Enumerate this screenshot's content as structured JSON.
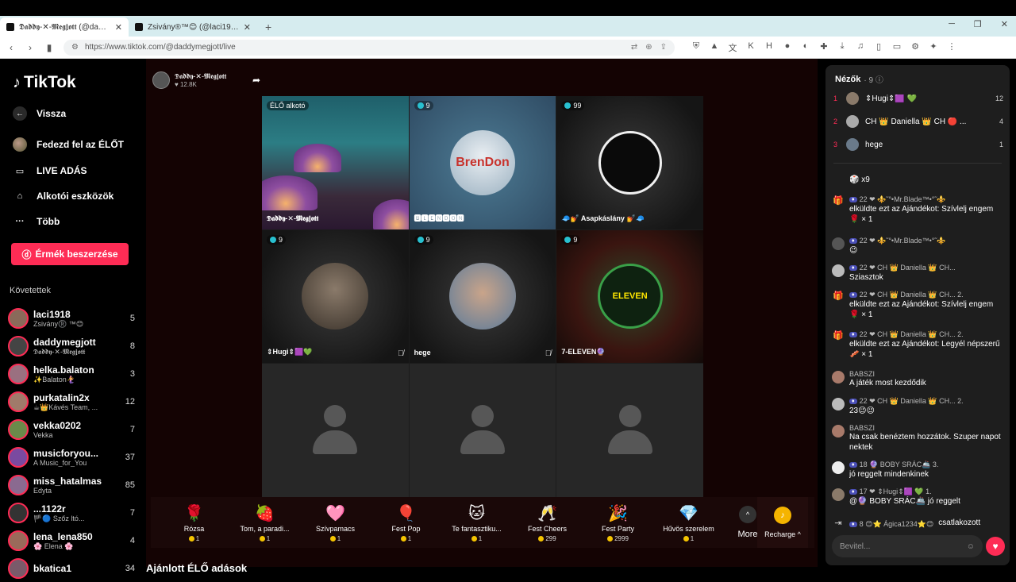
{
  "browser": {
    "tabs": [
      {
        "title": "𝕯𝖆𝖉𝖉𝖞-✕-𝕸𝖊𝖌𝖏𝖔𝖙𝖙 (@daddymegjott)",
        "active": true
      },
      {
        "title": "Zsivány®™😊 (@laci1918) ÉLŐ a",
        "active": false
      }
    ],
    "url": "https://www.tiktok.com/@daddymegjott/live"
  },
  "sidebar": {
    "logo": "TikTok",
    "nav": [
      {
        "label": "Vissza"
      },
      {
        "label": "Fedezd fel az ÉLŐT"
      },
      {
        "label": "LIVE ADÁS"
      },
      {
        "label": "Alkotói eszközök"
      },
      {
        "label": "Több"
      }
    ],
    "coin_button": "Érmék beszerzése",
    "following_title": "Követettek",
    "following": [
      {
        "name": "laci1918",
        "sub": "Zsivány®️ ™😊",
        "count": "5"
      },
      {
        "name": "daddymegjott",
        "sub": "𝕯𝖆𝖉𝖉𝖞-✕-𝕸𝖊𝖌𝖏𝖔𝖙𝖙",
        "count": "8"
      },
      {
        "name": "helka.balaton",
        "sub": "✨Balaton🧜‍♀️",
        "count": "3"
      },
      {
        "name": "purkatalin2x",
        "sub": "☕👑Kávés Team, ...",
        "count": "12"
      },
      {
        "name": "vekka0202",
        "sub": "Vekka",
        "count": "7"
      },
      {
        "name": "musicforyou...",
        "sub": "A Music_for_You",
        "count": "37"
      },
      {
        "name": "miss_hatalmas",
        "sub": "Edyta",
        "count": "85"
      },
      {
        "name": "...1122r",
        "sub": "🏴🔵 Szőz ltó...",
        "count": "7"
      },
      {
        "name": "lena_lena850",
        "sub": "🌸 Elena 🌸",
        "count": "4"
      },
      {
        "name": "bkatica1",
        "sub": "",
        "count": "34"
      }
    ]
  },
  "host": {
    "name": "𝕯𝖆𝖉𝖉𝖞-✕-𝕸𝖊𝖌𝖏𝖔𝖙𝖙",
    "likes": "♥ 12.8K"
  },
  "grid": [
    {
      "label": "𝕯𝖆𝖉𝖉𝖞-✕-𝕸𝖊𝖌𝖏𝖔𝖙𝖙",
      "badge": "ÉLŐ alkotó"
    },
    {
      "label": "🅱🅻🅴🅽🅳🅾🅽",
      "badge": "9",
      "avatar_text": "BrenDon"
    },
    {
      "label": "🧢💅 Asapkáslány 💅🧢",
      "badge": "99"
    },
    {
      "label": "⇕Hugi⇕🟪💚",
      "badge": "9"
    },
    {
      "label": "hege",
      "badge": "9"
    },
    {
      "label": "7-ELEVEN🔮",
      "badge": "9",
      "avatar_text": "ELEVEN"
    },
    {
      "label": ""
    },
    {
      "label": ""
    },
    {
      "label": ""
    }
  ],
  "gifts": [
    {
      "name": "Rózsa",
      "price": "1",
      "icon": "🌹"
    },
    {
      "name": "Tom, a paradi...",
      "price": "1",
      "icon": "🍓"
    },
    {
      "name": "Szívpamacs",
      "price": "1",
      "icon": "🩷"
    },
    {
      "name": "Fest Pop",
      "price": "1",
      "icon": "🎈"
    },
    {
      "name": "Te fantasztiku...",
      "price": "1",
      "icon": "🐱"
    },
    {
      "name": "Fest Cheers",
      "price": "299",
      "icon": "🥂"
    },
    {
      "name": "Fest Party",
      "price": "2999",
      "icon": "🎉"
    },
    {
      "name": "Hűvös szerelem",
      "price": "1",
      "icon": "💎"
    }
  ],
  "more_label": "More",
  "recharge_label": "Recharge ^",
  "recommended": "Ajánlott ÉLŐ adások",
  "viewers": {
    "title": "Nézők",
    "count": "· 9 ⓘ",
    "top": [
      {
        "rank": "1",
        "name": "⇕Hugi⇕🟪 💚",
        "score": "12"
      },
      {
        "rank": "2",
        "name": "CH 👑 Daniella 👑 CH 🔴 ...",
        "score": "4"
      },
      {
        "rank": "3",
        "name": "hege",
        "score": "1"
      }
    ]
  },
  "chat": [
    {
      "head": "",
      "text": "🎲 x9",
      "type": "gift"
    },
    {
      "head": "22 ❤ ⚜️˜°•Mr.Blade™•°˜⚜️",
      "text": "elküldte ezt az Ajándékot: Szívlelj engem 🌹 × 1",
      "type": "gift"
    },
    {
      "head": "22 ❤ ⚜️˜°•Mr.Blade™•°˜⚜️",
      "text": "😉",
      "type": "user"
    },
    {
      "head": "22 ❤ CH 👑 Daniella 👑 CH...",
      "text": "Sziasztok",
      "type": "user"
    },
    {
      "head": "22 ❤ CH 👑 Daniella 👑 CH...  2.",
      "text": "elküldte ezt az Ajándékot: Szívlelj engem 🌹 × 1",
      "type": "gift"
    },
    {
      "head": "22 ❤ CH 👑 Daniella 👑 CH...  2.",
      "text": "elküldte ezt az Ajándékot: Legyél népszerű 🥓 × 1",
      "type": "gift"
    },
    {
      "head": "BABSZI",
      "text": "A játék most kezdődik",
      "type": "user"
    },
    {
      "head": "22 ❤ CH 👑 Daniella 👑 CH...  2.",
      "text": "23😉😉",
      "type": "user"
    },
    {
      "head": "BABSZI",
      "text": "Na csak benéztem hozzátok. Szuper napot nektek",
      "type": "user"
    },
    {
      "head": "18 🔮 BOBY SRÁC🚢  3.",
      "text": "jó reggelt mindenkinek",
      "type": "user"
    },
    {
      "head": "17 ❤ ⇕Hugi⇕🟪 💚  1.",
      "text": "@🔮 BOBY SRÁC🚢 jó reggelt",
      "type": "user"
    },
    {
      "head": "8 😊⭐ Ágica1234⭐😊",
      "text": "csatlakozott",
      "type": "join"
    }
  ],
  "chat_input_placeholder": "Bevitel..."
}
